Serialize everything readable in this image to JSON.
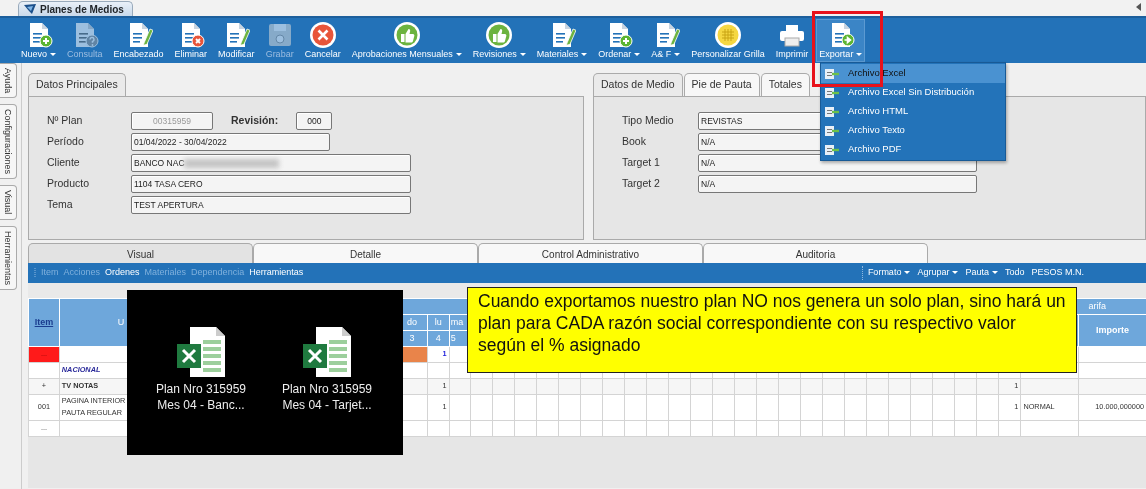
{
  "window": {
    "title": "Planes de Medios"
  },
  "toolbar": [
    {
      "label": "Nuevo",
      "kind": "doc-plus",
      "dropdown": true,
      "disabled": false,
      "open": false,
      "highlighted": false
    },
    {
      "label": "Consulta",
      "kind": "doc-question",
      "dropdown": false,
      "disabled": true,
      "open": false,
      "highlighted": false
    },
    {
      "label": "Encabezado",
      "kind": "doc-pencil",
      "dropdown": false,
      "disabled": false,
      "open": false,
      "highlighted": false
    },
    {
      "label": "Eliminar",
      "kind": "doc-x",
      "dropdown": false,
      "disabled": false,
      "open": false,
      "highlighted": false
    },
    {
      "label": "Modificar",
      "kind": "doc-pencil",
      "dropdown": false,
      "disabled": false,
      "open": false,
      "highlighted": false
    },
    {
      "label": "Grabar",
      "kind": "floppy",
      "dropdown": false,
      "disabled": true,
      "open": false,
      "highlighted": false
    },
    {
      "label": "Cancelar",
      "kind": "cancel",
      "dropdown": false,
      "disabled": false,
      "open": false,
      "highlighted": false
    },
    {
      "label": "Aprobaciones Mensuales",
      "kind": "thumb",
      "dropdown": true,
      "disabled": false,
      "open": false,
      "highlighted": false
    },
    {
      "label": "Revisiones",
      "kind": "thumb",
      "dropdown": true,
      "disabled": false,
      "open": false,
      "highlighted": false
    },
    {
      "label": "Materiales",
      "kind": "doc-pencil",
      "dropdown": true,
      "disabled": false,
      "open": false,
      "highlighted": false
    },
    {
      "label": "Ordenar",
      "kind": "doc-plus",
      "dropdown": true,
      "disabled": false,
      "open": false,
      "highlighted": false
    },
    {
      "label": "A& F",
      "kind": "doc-pencil",
      "dropdown": true,
      "disabled": false,
      "open": false,
      "highlighted": false
    },
    {
      "label": "Personalizar Grilla",
      "kind": "grid",
      "dropdown": false,
      "disabled": false,
      "open": false,
      "highlighted": false
    },
    {
      "label": "Imprimir",
      "kind": "printer",
      "dropdown": false,
      "disabled": false,
      "open": false,
      "highlighted": false
    },
    {
      "label": "Exportar",
      "kind": "doc-arrow",
      "dropdown": true,
      "disabled": false,
      "open": true,
      "highlighted": true
    }
  ],
  "export_menu": [
    {
      "label": "Archivo Excel",
      "selected": true
    },
    {
      "label": "Archivo Excel Sin Distribución",
      "selected": false
    },
    {
      "label": "Archivo HTML",
      "selected": false
    },
    {
      "label": "Archivo Texto",
      "selected": false
    },
    {
      "label": "Archivo PDF",
      "selected": false
    }
  ],
  "side_tabs": [
    "Ayuda",
    "Configuraciones",
    "Visual",
    "Herramientas"
  ],
  "datos_principales": {
    "tab": "Datos Principales",
    "plan": {
      "label": "Nº Plan",
      "value": "00315959",
      "disabled": true
    },
    "revision": {
      "label": "Revisión:",
      "value": "000"
    },
    "fields": [
      {
        "label": "Período",
        "value": "01/04/2022 - 30/04/2022",
        "redacted": false
      },
      {
        "label": "Cliente",
        "value": "BANCO NAC",
        "redacted": true
      },
      {
        "label": "Producto",
        "value": "1104 TASA CERO",
        "redacted": false
      },
      {
        "label": "Tema",
        "value": "TEST APERTURA",
        "redacted": false
      }
    ]
  },
  "datos_medio": {
    "tabs": [
      {
        "label": "Datos de Medio",
        "selected": true
      },
      {
        "label": "Pie de Pauta",
        "selected": false
      },
      {
        "label": "Totales",
        "selected": false
      }
    ],
    "fields": [
      {
        "label": "Tipo Medio",
        "value": "REVISTAS"
      },
      {
        "label": "Book",
        "value": "N/A"
      },
      {
        "label": "Target 1",
        "value": "N/A"
      },
      {
        "label": "Target 2",
        "value": "N/A"
      }
    ]
  },
  "view_tabs": [
    {
      "label": "Visual",
      "selected": true
    },
    {
      "label": "Detalle",
      "selected": false
    },
    {
      "label": "Control Administrativo",
      "selected": false
    },
    {
      "label": "Auditoria",
      "selected": false
    }
  ],
  "grid_menu": [
    {
      "label": "Item",
      "disabled": true
    },
    {
      "label": "Acciones",
      "disabled": true
    },
    {
      "label": "Ordenes",
      "disabled": false
    },
    {
      "label": "Materiales",
      "disabled": true
    },
    {
      "label": "Dependencia",
      "disabled": true
    },
    {
      "label": "Herramientas",
      "disabled": false
    }
  ],
  "grid_options": [
    {
      "label": "Formato",
      "dropdown": true
    },
    {
      "label": "Agrupar",
      "dropdown": true
    },
    {
      "label": "Pauta",
      "dropdown": true
    },
    {
      "label": "Todo",
      "dropdown": false
    },
    {
      "label": "PESOS M.N.",
      "dropdown": false
    }
  ],
  "table": {
    "item_header": "Item",
    "column_2_header": "U",
    "day_headers": [
      {
        "day": "do",
        "number": "3"
      },
      {
        "day": "lu",
        "number": "4"
      },
      {
        "day": "ma",
        "number": "5"
      }
    ],
    "group_header": "arifa",
    "importe_header": "Importe",
    "rows": [
      {
        "kind": "current",
        "item": "...",
        "description": [],
        "day_4": "1",
        "column_last": "",
        "tarifa": "",
        "importe": ""
      },
      {
        "kind": "group",
        "item": "",
        "description": [
          "NACIONAL"
        ],
        "day_4": "",
        "column_last": "",
        "tarifa": "",
        "importe": ""
      },
      {
        "kind": "subtotal",
        "item": "+",
        "description": [
          "TV NOTAS"
        ],
        "day_4": "1",
        "column_last": "1",
        "tarifa": "",
        "importe": ""
      },
      {
        "kind": "row",
        "item": "001",
        "description": [
          "PAGINA INTERIOR",
          "PAUTA REGULAR"
        ],
        "day_4": "1",
        "column_last": "1",
        "tarifa": "NORMAL",
        "importe": "10.000,000000"
      },
      {
        "kind": "row",
        "item": "...",
        "description": [],
        "day_4": "",
        "column_last": "",
        "tarifa": "",
        "importe": ""
      }
    ]
  },
  "files_popup": [
    {
      "title": "Plan Nro 315959",
      "subtitle": "Mes 04 - Banc..."
    },
    {
      "title": "Plan Nro 315959",
      "subtitle": "Mes 04 - Tarjet..."
    }
  ],
  "callout": "Cuando exportamos nuestro plan NO nos genera un solo plan, sino hará un plan para CADA razón social correspondiente con su respectivo valor según el % asignado"
}
